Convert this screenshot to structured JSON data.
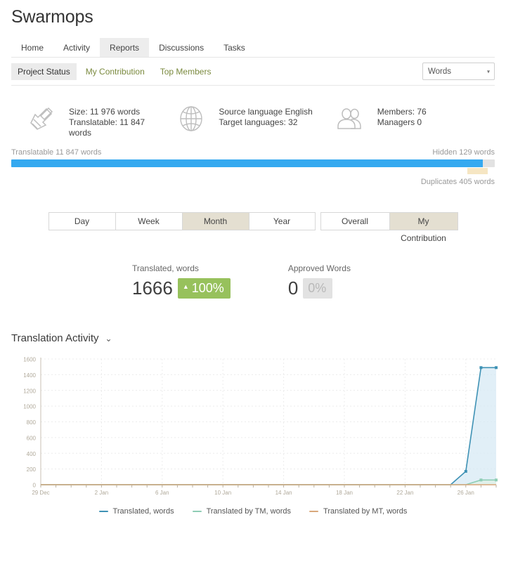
{
  "header": {
    "title": "Swarmops"
  },
  "main_nav": {
    "tabs": [
      {
        "label": "Home",
        "active": false
      },
      {
        "label": "Activity",
        "active": false
      },
      {
        "label": "Reports",
        "active": true
      },
      {
        "label": "Discussions",
        "active": false
      },
      {
        "label": "Tasks",
        "active": false
      }
    ]
  },
  "sub_nav": {
    "tabs": [
      {
        "label": "Project Status",
        "active": true
      },
      {
        "label": "My Contribution",
        "active": false
      },
      {
        "label": "Top Members",
        "active": false
      }
    ],
    "unit_select": {
      "value": "Words",
      "caret": "▾"
    }
  },
  "info": {
    "size": {
      "icon": "tools-icon",
      "line1": "Size: 11 976 words",
      "line2": "Translatable: 11 847 words"
    },
    "language": {
      "icon": "globe-icon",
      "line1": "Source language English",
      "line2": "Target languages: 32"
    },
    "members": {
      "icon": "users-icon",
      "line1": "Members: 76",
      "line2": "Managers 0"
    }
  },
  "progress": {
    "left_label": "Translatable 11 847 words",
    "right_label": "Hidden 129 words",
    "duplicates_label": "Duplicates 405 words",
    "fill_percent": 97.5,
    "duplicate_offset_percent": 94.3,
    "duplicate_width_percent": 4.2,
    "fill_color": "#35a9f0",
    "track_color": "#e2e2e2",
    "duplicate_color": "#f6e6c3"
  },
  "period_toggle": {
    "range": [
      {
        "label": "Day",
        "active": false
      },
      {
        "label": "Week",
        "active": false
      },
      {
        "label": "Month",
        "active": true
      },
      {
        "label": "Year",
        "active": false
      }
    ],
    "scope": [
      {
        "label": "Overall",
        "active": false
      },
      {
        "label": "My Contribution",
        "active": true
      }
    ],
    "active_color": "#e4dfd1"
  },
  "stats": [
    {
      "label": "Translated, words",
      "value": "1666",
      "badge": "100%",
      "badge_arrow": "▲",
      "badge_color": "#97c15c",
      "badge_muted": false
    },
    {
      "label": "Approved Words",
      "value": "0",
      "badge": "0%",
      "badge_arrow": "",
      "badge_color": "#e2e2e2",
      "badge_muted": true
    }
  ],
  "activity": {
    "title": "Translation Activity",
    "caret": "⌄"
  },
  "chart_data": {
    "type": "line",
    "title": "Translation Activity",
    "xlabel": "",
    "ylabel": "",
    "ylim": [
      0,
      1600
    ],
    "y_ticks": [
      0,
      200,
      400,
      600,
      800,
      1000,
      1200,
      1400,
      1600
    ],
    "x_tick_labels": [
      "29 Dec",
      "2 Jan",
      "6 Jan",
      "10 Jan",
      "14 Jan",
      "18 Jan",
      "22 Jan",
      "26 Jan"
    ],
    "x": [
      "29 Dec",
      "30 Dec",
      "31 Dec",
      "1 Jan",
      "2 Jan",
      "3 Jan",
      "4 Jan",
      "5 Jan",
      "6 Jan",
      "7 Jan",
      "8 Jan",
      "9 Jan",
      "10 Jan",
      "11 Jan",
      "12 Jan",
      "13 Jan",
      "14 Jan",
      "15 Jan",
      "16 Jan",
      "17 Jan",
      "18 Jan",
      "19 Jan",
      "20 Jan",
      "21 Jan",
      "22 Jan",
      "23 Jan",
      "24 Jan",
      "25 Jan",
      "26 Jan",
      "27 Jan",
      "28 Jan"
    ],
    "grid": true,
    "legend_position": "bottom",
    "series": [
      {
        "name": "Translated, words",
        "color": "#3f92b5",
        "fill": "#d7e9f4",
        "values": [
          0,
          0,
          0,
          0,
          0,
          0,
          0,
          0,
          0,
          0,
          0,
          0,
          0,
          0,
          0,
          0,
          0,
          0,
          0,
          0,
          0,
          0,
          0,
          0,
          0,
          0,
          0,
          0,
          170,
          1490,
          1490
        ]
      },
      {
        "name": "Translated by TM, words",
        "color": "#8fcdb5",
        "fill": "#dff0e6",
        "values": [
          0,
          0,
          0,
          0,
          0,
          0,
          0,
          0,
          0,
          0,
          0,
          0,
          0,
          0,
          0,
          0,
          0,
          0,
          0,
          0,
          0,
          0,
          0,
          0,
          0,
          0,
          0,
          0,
          0,
          60,
          60
        ]
      },
      {
        "name": "Translated by MT, words",
        "color": "#d9a87c",
        "fill": "#f3e3d2",
        "values": [
          0,
          0,
          0,
          0,
          0,
          0,
          0,
          0,
          0,
          0,
          0,
          0,
          0,
          0,
          0,
          0,
          0,
          0,
          0,
          0,
          0,
          0,
          0,
          0,
          0,
          0,
          0,
          0,
          0,
          0,
          0
        ]
      }
    ]
  }
}
